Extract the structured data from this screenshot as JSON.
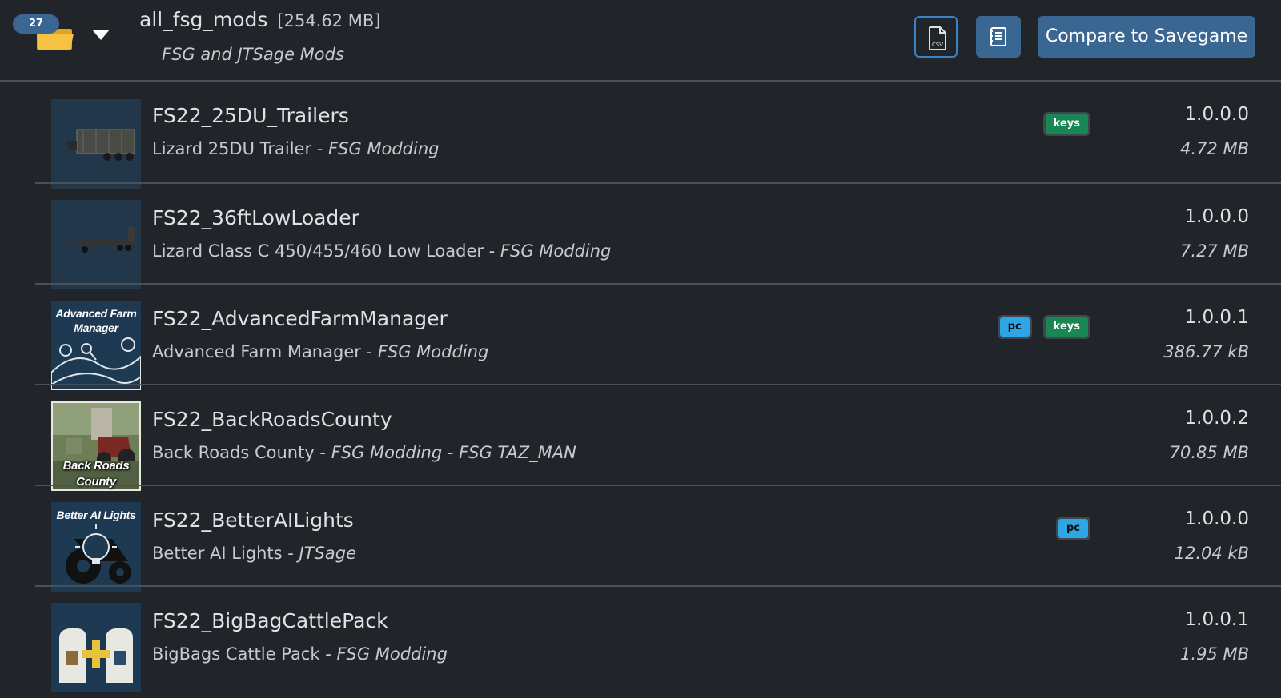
{
  "header": {
    "count": "27",
    "title": "all_fsg_mods",
    "size": "[254.62 MB]",
    "description": "FSG and JTSage Mods",
    "csv_label": "CSV",
    "compare_label": "Compare to Savegame"
  },
  "mods": [
    {
      "name": "FS22_25DU_Trailers",
      "title": "Lizard 25DU Trailer",
      "authors": "FSG Modding",
      "version": "1.0.0.0",
      "size": "4.72 MB",
      "badges": [
        "keys"
      ],
      "thumb": "trailer"
    },
    {
      "name": "FS22_36ftLowLoader",
      "title": "Lizard Class C 450/455/460 Low Loader",
      "authors": "FSG Modding",
      "version": "1.0.0.0",
      "size": "7.27 MB",
      "badges": [],
      "thumb": "lowloader"
    },
    {
      "name": "FS22_AdvancedFarmManager",
      "title": "Advanced Farm Manager",
      "authors": "FSG Modding",
      "version": "1.0.0.1",
      "size": "386.77 kB",
      "badges": [
        "pc",
        "keys"
      ],
      "thumb": "afm",
      "thumb_text": [
        "Advanced Farm",
        "Manager"
      ]
    },
    {
      "name": "FS22_BackRoadsCounty",
      "title": "Back Roads County",
      "authors": "FSG Modding - FSG TAZ_MAN",
      "version": "1.0.0.2",
      "size": "70.85 MB",
      "badges": [],
      "thumb": "brc",
      "thumb_text": [
        "Back Roads",
        "County"
      ]
    },
    {
      "name": "FS22_BetterAILights",
      "title": "Better AI Lights",
      "authors": "JTSage",
      "version": "1.0.0.0",
      "size": "12.04 kB",
      "badges": [
        "pc"
      ],
      "thumb": "bal",
      "thumb_text": [
        "Better AI Lights"
      ]
    },
    {
      "name": "FS22_BigBagCattlePack",
      "title": "BigBags Cattle Pack",
      "authors": "FSG Modding",
      "version": "1.0.0.1",
      "size": "1.95 MB",
      "badges": [],
      "thumb": "bigbag"
    }
  ],
  "colors": {
    "background": "#212529",
    "primary": "#3a6792",
    "keys_badge": "#198754",
    "pc_badge": "#2ea6e6"
  }
}
